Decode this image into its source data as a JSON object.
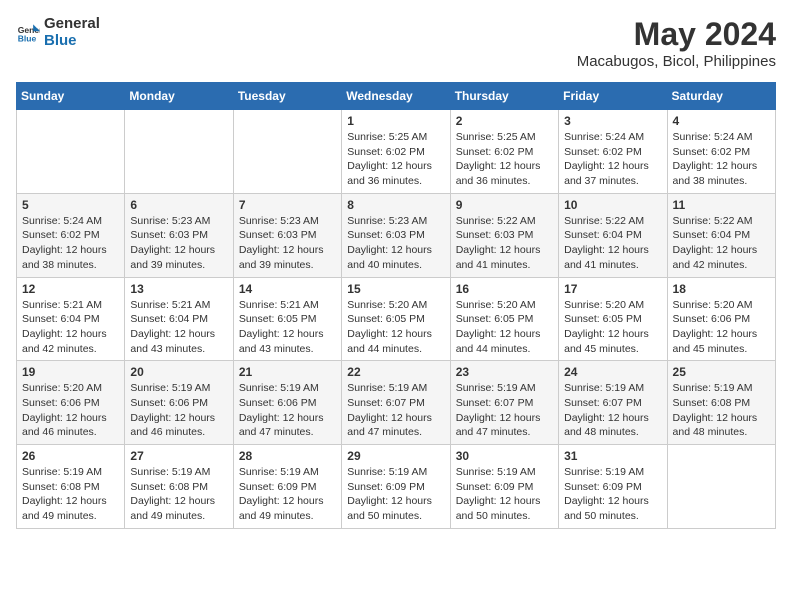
{
  "logo": {
    "general": "General",
    "blue": "Blue"
  },
  "title": "May 2024",
  "subtitle": "Macabugos, Bicol, Philippines",
  "days_header": [
    "Sunday",
    "Monday",
    "Tuesday",
    "Wednesday",
    "Thursday",
    "Friday",
    "Saturday"
  ],
  "weeks": [
    [
      {
        "day": "",
        "info": ""
      },
      {
        "day": "",
        "info": ""
      },
      {
        "day": "",
        "info": ""
      },
      {
        "day": "1",
        "info": "Sunrise: 5:25 AM\nSunset: 6:02 PM\nDaylight: 12 hours\nand 36 minutes."
      },
      {
        "day": "2",
        "info": "Sunrise: 5:25 AM\nSunset: 6:02 PM\nDaylight: 12 hours\nand 36 minutes."
      },
      {
        "day": "3",
        "info": "Sunrise: 5:24 AM\nSunset: 6:02 PM\nDaylight: 12 hours\nand 37 minutes."
      },
      {
        "day": "4",
        "info": "Sunrise: 5:24 AM\nSunset: 6:02 PM\nDaylight: 12 hours\nand 38 minutes."
      }
    ],
    [
      {
        "day": "5",
        "info": "Sunrise: 5:24 AM\nSunset: 6:02 PM\nDaylight: 12 hours\nand 38 minutes."
      },
      {
        "day": "6",
        "info": "Sunrise: 5:23 AM\nSunset: 6:03 PM\nDaylight: 12 hours\nand 39 minutes."
      },
      {
        "day": "7",
        "info": "Sunrise: 5:23 AM\nSunset: 6:03 PM\nDaylight: 12 hours\nand 39 minutes."
      },
      {
        "day": "8",
        "info": "Sunrise: 5:23 AM\nSunset: 6:03 PM\nDaylight: 12 hours\nand 40 minutes."
      },
      {
        "day": "9",
        "info": "Sunrise: 5:22 AM\nSunset: 6:03 PM\nDaylight: 12 hours\nand 41 minutes."
      },
      {
        "day": "10",
        "info": "Sunrise: 5:22 AM\nSunset: 6:04 PM\nDaylight: 12 hours\nand 41 minutes."
      },
      {
        "day": "11",
        "info": "Sunrise: 5:22 AM\nSunset: 6:04 PM\nDaylight: 12 hours\nand 42 minutes."
      }
    ],
    [
      {
        "day": "12",
        "info": "Sunrise: 5:21 AM\nSunset: 6:04 PM\nDaylight: 12 hours\nand 42 minutes."
      },
      {
        "day": "13",
        "info": "Sunrise: 5:21 AM\nSunset: 6:04 PM\nDaylight: 12 hours\nand 43 minutes."
      },
      {
        "day": "14",
        "info": "Sunrise: 5:21 AM\nSunset: 6:05 PM\nDaylight: 12 hours\nand 43 minutes."
      },
      {
        "day": "15",
        "info": "Sunrise: 5:20 AM\nSunset: 6:05 PM\nDaylight: 12 hours\nand 44 minutes."
      },
      {
        "day": "16",
        "info": "Sunrise: 5:20 AM\nSunset: 6:05 PM\nDaylight: 12 hours\nand 44 minutes."
      },
      {
        "day": "17",
        "info": "Sunrise: 5:20 AM\nSunset: 6:05 PM\nDaylight: 12 hours\nand 45 minutes."
      },
      {
        "day": "18",
        "info": "Sunrise: 5:20 AM\nSunset: 6:06 PM\nDaylight: 12 hours\nand 45 minutes."
      }
    ],
    [
      {
        "day": "19",
        "info": "Sunrise: 5:20 AM\nSunset: 6:06 PM\nDaylight: 12 hours\nand 46 minutes."
      },
      {
        "day": "20",
        "info": "Sunrise: 5:19 AM\nSunset: 6:06 PM\nDaylight: 12 hours\nand 46 minutes."
      },
      {
        "day": "21",
        "info": "Sunrise: 5:19 AM\nSunset: 6:06 PM\nDaylight: 12 hours\nand 47 minutes."
      },
      {
        "day": "22",
        "info": "Sunrise: 5:19 AM\nSunset: 6:07 PM\nDaylight: 12 hours\nand 47 minutes."
      },
      {
        "day": "23",
        "info": "Sunrise: 5:19 AM\nSunset: 6:07 PM\nDaylight: 12 hours\nand 47 minutes."
      },
      {
        "day": "24",
        "info": "Sunrise: 5:19 AM\nSunset: 6:07 PM\nDaylight: 12 hours\nand 48 minutes."
      },
      {
        "day": "25",
        "info": "Sunrise: 5:19 AM\nSunset: 6:08 PM\nDaylight: 12 hours\nand 48 minutes."
      }
    ],
    [
      {
        "day": "26",
        "info": "Sunrise: 5:19 AM\nSunset: 6:08 PM\nDaylight: 12 hours\nand 49 minutes."
      },
      {
        "day": "27",
        "info": "Sunrise: 5:19 AM\nSunset: 6:08 PM\nDaylight: 12 hours\nand 49 minutes."
      },
      {
        "day": "28",
        "info": "Sunrise: 5:19 AM\nSunset: 6:09 PM\nDaylight: 12 hours\nand 49 minutes."
      },
      {
        "day": "29",
        "info": "Sunrise: 5:19 AM\nSunset: 6:09 PM\nDaylight: 12 hours\nand 50 minutes."
      },
      {
        "day": "30",
        "info": "Sunrise: 5:19 AM\nSunset: 6:09 PM\nDaylight: 12 hours\nand 50 minutes."
      },
      {
        "day": "31",
        "info": "Sunrise: 5:19 AM\nSunset: 6:09 PM\nDaylight: 12 hours\nand 50 minutes."
      },
      {
        "day": "",
        "info": ""
      }
    ]
  ]
}
